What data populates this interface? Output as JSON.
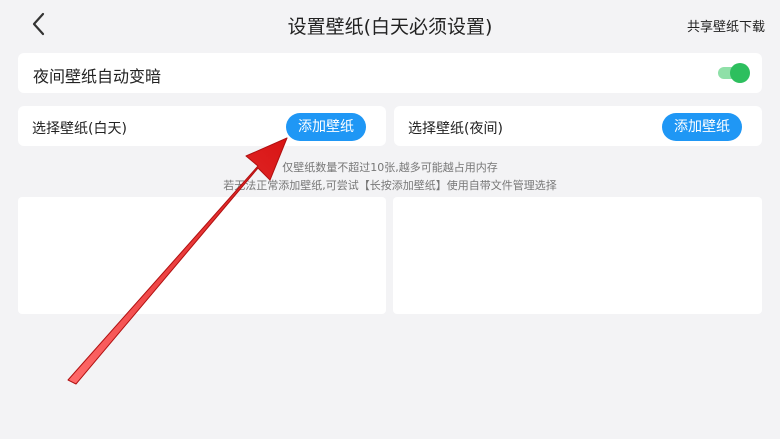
{
  "header": {
    "title": "设置壁纸(白天必须设置)",
    "share_label": "共享壁纸下载"
  },
  "night_auto": {
    "label": "夜间壁纸自动变暗",
    "enabled": true
  },
  "day_picker": {
    "label": "选择壁纸(白天)",
    "button_label": "添加壁纸"
  },
  "night_picker": {
    "label": "选择壁纸(夜间)",
    "button_label": "添加壁纸"
  },
  "hints": {
    "line1": "仅壁纸数量不超过10张,越多可能越占用内存",
    "line2": "若无法正常添加壁纸,可尝试【长按添加壁纸】使用自带文件管理选择"
  },
  "colors": {
    "accent": "#1f97f5",
    "toggle_on": "#2dbf5e",
    "annotation_arrow": "#e02020"
  }
}
